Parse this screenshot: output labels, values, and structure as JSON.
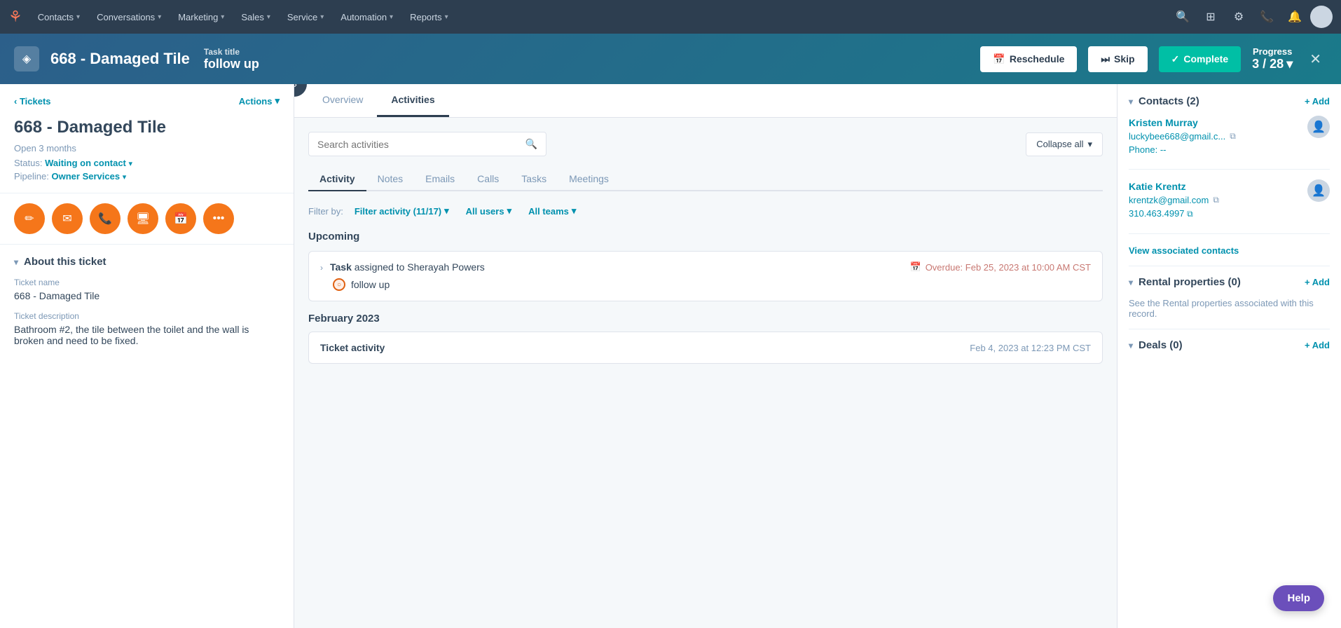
{
  "nav": {
    "items": [
      {
        "label": "Contacts",
        "id": "contacts"
      },
      {
        "label": "Conversations",
        "id": "conversations"
      },
      {
        "label": "Marketing",
        "id": "marketing"
      },
      {
        "label": "Sales",
        "id": "sales"
      },
      {
        "label": "Service",
        "id": "service"
      },
      {
        "label": "Automation",
        "id": "automation"
      },
      {
        "label": "Reports",
        "id": "reports"
      }
    ]
  },
  "taskbar": {
    "record_title": "668 - Damaged Tile",
    "task_title_label": "Task title",
    "task_title_value": "follow up",
    "reschedule_label": "Reschedule",
    "skip_label": "Skip",
    "complete_label": "Complete",
    "progress_label": "Progress",
    "progress_value": "3 / 28"
  },
  "left_panel": {
    "breadcrumb_label": "Tickets",
    "actions_label": "Actions",
    "record_title": "668 - Damaged Tile",
    "record_age": "Open 3 months",
    "status_label": "Status:",
    "status_value": "Waiting on contact",
    "pipeline_label": "Pipeline:",
    "pipeline_value": "Owner Services",
    "about_title": "About this ticket",
    "ticket_name_label": "Ticket name",
    "ticket_name_value": "668 - Damaged Tile",
    "ticket_desc_label": "Ticket description",
    "ticket_desc_value": "Bathroom #2, the tile between the toilet and the wall is broken and need to be fixed."
  },
  "center_panel": {
    "tab_overview": "Overview",
    "tab_activities": "Activities",
    "search_placeholder": "Search activities",
    "collapse_label": "Collapse all",
    "sub_tabs": [
      "Activity",
      "Notes",
      "Emails",
      "Calls",
      "Tasks",
      "Meetings"
    ],
    "filter_label": "Filter by:",
    "filter_activity": "Filter activity (11/17)",
    "filter_users": "All users",
    "filter_teams": "All teams",
    "upcoming_label": "Upcoming",
    "task_assigned": "Task",
    "assigned_to": "assigned to Sherayah Powers",
    "overdue_text": "Overdue: Feb 25, 2023 at 10:00 AM CST",
    "task_followup": "follow up",
    "month_label": "February 2023",
    "ticket_activity_label": "Ticket activity",
    "ticket_activity_date": "Feb 4, 2023 at 12:23 PM CST"
  },
  "right_panel": {
    "contacts_title": "Contacts (2)",
    "add_label": "+ Add",
    "contact1": {
      "name": "Kristen Murray",
      "email": "luckybee668@gmail.c...",
      "phone_label": "Phone:",
      "phone_value": "--"
    },
    "contact2": {
      "name": "Katie Krentz",
      "email": "krentzk@gmail.com",
      "phone": "310.463.4997"
    },
    "view_contacts_label": "View associated contacts",
    "rental_title": "Rental properties (0)",
    "rental_desc": "See the Rental properties associated with this record.",
    "deals_title": "Deals (0)"
  },
  "help_label": "Help"
}
